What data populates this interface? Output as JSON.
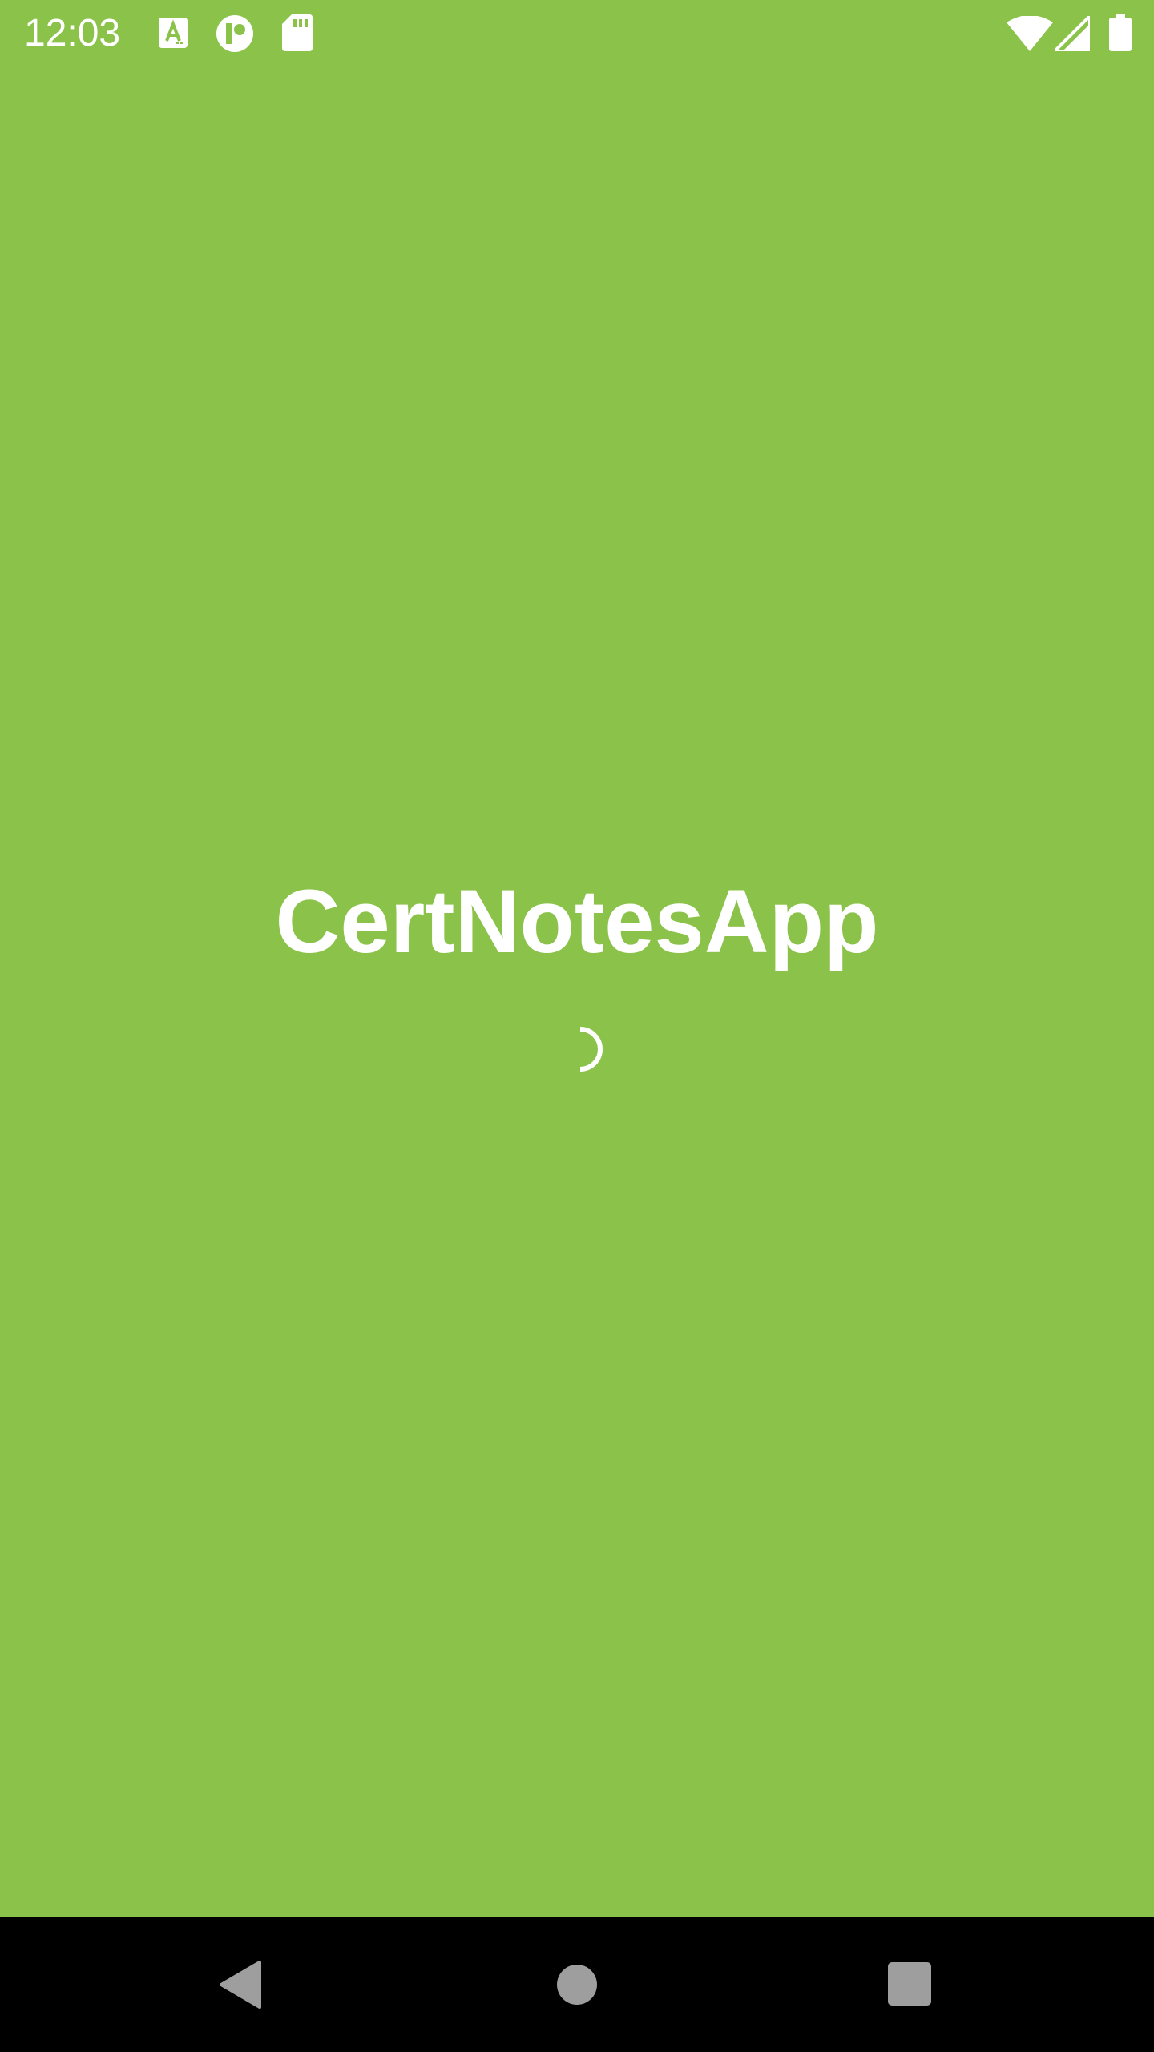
{
  "status_bar": {
    "time": "12:03",
    "icons": [
      "font-a-icon",
      "tile-icon",
      "sd-card-icon",
      "wifi-icon",
      "signal-icon",
      "battery-icon"
    ]
  },
  "main": {
    "app_title": "CertNotesApp",
    "loading_indicator": "spinner-icon"
  },
  "nav_bar": {
    "buttons": [
      "back-icon",
      "home-icon",
      "recents-icon"
    ]
  },
  "colors": {
    "background": "#8bc34a",
    "text": "#ffffff",
    "nav_background": "#000000",
    "nav_buttons": "#9e9e9e"
  }
}
